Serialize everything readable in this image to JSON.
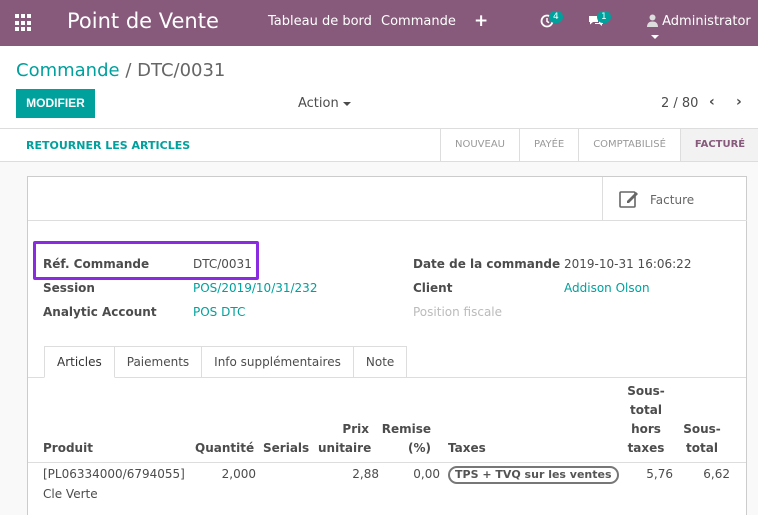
{
  "navbar": {
    "brand": "Point de Vente",
    "menu": [
      "Tableau de bord",
      "Commande"
    ],
    "plus": "+",
    "activity_count": "4",
    "message_count": "1",
    "user": "Administrator",
    "color": "#875a7b"
  },
  "breadcrumb": {
    "parent": "Commande",
    "separator": "/",
    "current": "DTC/0031"
  },
  "toolbar": {
    "modify_label": "MODIFIER",
    "action_label": "Action"
  },
  "pager": {
    "value": "2 / 80",
    "prev": "‹",
    "next": "›"
  },
  "statusbar": {
    "return_label": "RETOURNER LES ARTICLES",
    "states": [
      {
        "label": "NOUVEAU",
        "active": false
      },
      {
        "label": "PAYÉE",
        "active": false
      },
      {
        "label": "COMPTABILISÉ",
        "active": false
      },
      {
        "label": "FACTURÉ",
        "active": true
      }
    ]
  },
  "button_box": {
    "invoice_label": "Facture",
    "icon": "edit-icon"
  },
  "fields": {
    "ref_label": "Réf. Commande",
    "ref_value": "DTC/0031",
    "session_label": "Session",
    "session_value": "POS/2019/10/31/232",
    "analytic_label": "Analytic Account",
    "analytic_value": "POS DTC",
    "date_label": "Date de la commande",
    "date_value": "2019-10-31 16:06:22",
    "client_label": "Client",
    "client_value": "Addison Olson",
    "fiscal_label": "Position fiscale"
  },
  "tabs": [
    {
      "label": "Articles",
      "active": true
    },
    {
      "label": "Paiements",
      "active": false
    },
    {
      "label": "Info supplémentaires",
      "active": false
    },
    {
      "label": "Note",
      "active": false
    }
  ],
  "table": {
    "headers": {
      "product": "Produit",
      "qty": "Quantité",
      "serials": "Serials",
      "price_1": "Prix",
      "price_2": "unitaire",
      "discount_1": "Remise",
      "discount_2": "(%)",
      "taxes": "Taxes",
      "subtotal_ht_1": "Sous-",
      "subtotal_ht_2": "total",
      "subtotal_ht_3": "hors",
      "subtotal_ht_4": "taxes",
      "subtotal_1": "Sous-",
      "subtotal_2": "total"
    },
    "rows": [
      {
        "product_line1": "[PL06334000/6794055]",
        "product_line2": "Cle Verte",
        "qty": "2,000",
        "price": "2,88",
        "discount": "0,00",
        "tax": "TPS + TVQ sur les ventes",
        "subtotal_ht": "5,76",
        "subtotal": "6,62"
      }
    ]
  },
  "colors": {
    "primary": "#00a09d",
    "brand": "#875a7b",
    "highlight": "#8a2be2"
  }
}
